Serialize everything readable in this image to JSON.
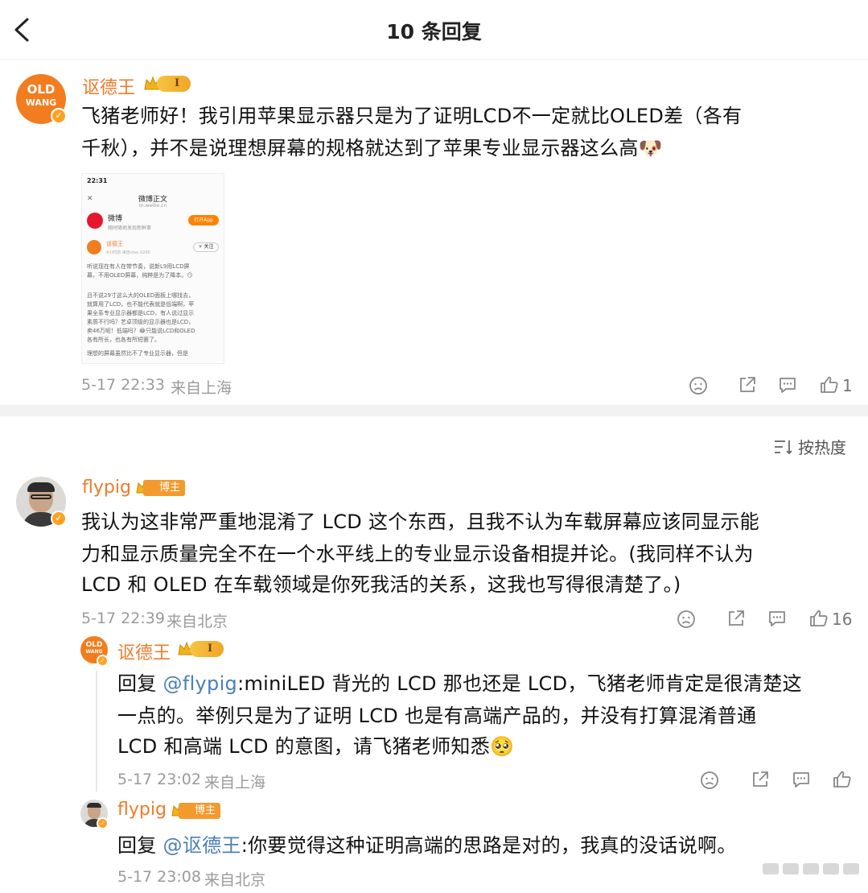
{
  "header": {
    "title": "10 条回复",
    "back_icon": "back-arrow-icon"
  },
  "main_comment": {
    "username": "讴德王",
    "level": "I",
    "avatar_text": "OLD WANG",
    "text_line1": "飞猪老师好！我引用苹果显示器只是为了证明LCD不一定就比OLED差（各有",
    "text_line2": "千秋），并不是说理想屏幕的规格就达到了苹果专业显示器这么高🐶",
    "image": {
      "status_time": "22:31",
      "page_title": "微博正文",
      "page_url": "m.weibo.cn",
      "app_name": "微博",
      "app_sub": "随时随地发现新鲜事",
      "open_app": "打开App",
      "post_user": "讴德王",
      "post_meta": "4小时前  来自vivo X200",
      "follow": "+ 关注",
      "lines": [
        "听说现在有人在带节奏，说新L9用LCD屏",
        "幕，不用OLED屏幕，纯粹是为了降本。😏",
        "且不说29寸这么大的OLED面板上哪找去，",
        "就算用了LCD，也不能代表就是低端啊，苹",
        "果全系专业显示器都是LCD，有人说过显示",
        "素质不行吗？艺卓顶级的显示器也是LCD，",
        "卖46万呢！低端吗？😂只能说LCD和OLED",
        "各有所长，也各有所短罢了。",
        "理想的屏幕虽然比不了专业显示器，但是"
      ]
    },
    "time": "5-17 22:33",
    "location": "来自上海",
    "likes": "1"
  },
  "sort_label": "按热度",
  "replies": [
    {
      "username": "flypig",
      "tag": "博主",
      "text_line1": "我认为这非常严重地混淆了 LCD 这个东西，且我不认为车载屏幕应该同显示能",
      "text_line2": "力和显示质量完全不在一个水平线上的专业显示设备相提并论。(我同样不认为",
      "text_line3": "LCD 和 OLED 在车载领域是你死我活的关系，这我也写得很清楚了。)",
      "time": "5-17 22:39",
      "location": "来自北京",
      "likes": "16"
    },
    {
      "username": "讴德王",
      "level": "I",
      "prefix": "回复 ",
      "mention": "@flypig",
      "text_line1": ":miniLED 背光的 LCD 那也还是 LCD，飞猪老师肯定是很清楚这",
      "text_line2": "一点的。举例只是为了证明 LCD 也是有高端产品的，并没有打算混淆普通",
      "text_line3": "LCD 和高端 LCD 的意图，请飞猪老师知悉🥺",
      "time": "5-17 23:02",
      "location": "来自上海"
    },
    {
      "username": "flypig",
      "tag": "博主",
      "prefix": "回复 ",
      "mention": "@讴德王",
      "text_line1": ":你要觉得这种证明高端的思路是对的，我真的没话说啊。",
      "time": "5-17 23:08",
      "location": "来自北京"
    }
  ],
  "colors": {
    "username": "#f07a2a",
    "mention": "#4a7fb8",
    "meta": "#9b9b9b"
  }
}
